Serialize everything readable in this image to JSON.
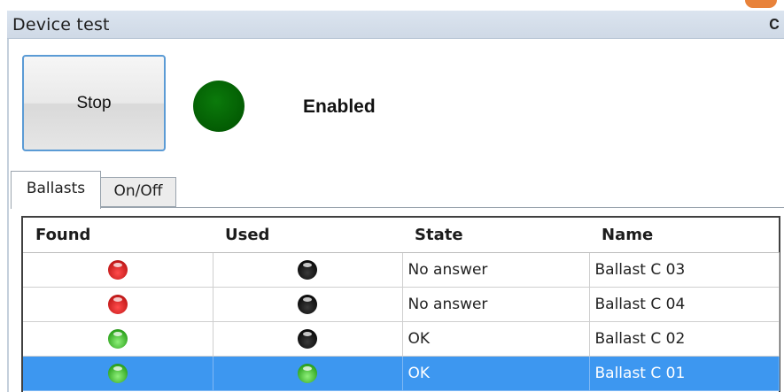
{
  "panel": {
    "title": "Device test"
  },
  "controls": {
    "stop_label": "Stop",
    "status_text": "Enabled",
    "status_color": "#036603"
  },
  "tabs": [
    {
      "label": "Ballasts",
      "active": true
    },
    {
      "label": "On/Off",
      "active": false
    }
  ],
  "grid": {
    "columns": [
      "Found",
      "Used",
      "State",
      "Name"
    ],
    "rows": [
      {
        "found": "red",
        "used": "black",
        "state": "No answer",
        "name": "Ballast C 03",
        "selected": false
      },
      {
        "found": "red",
        "used": "black",
        "state": "No answer",
        "name": "Ballast C 04",
        "selected": false
      },
      {
        "found": "green",
        "used": "black",
        "state": "OK",
        "name": "Ballast C 02",
        "selected": false
      },
      {
        "found": "green",
        "used": "green",
        "state": "OK",
        "name": "Ballast C 01",
        "selected": true
      }
    ]
  },
  "colors": {
    "selection": "#3d97f0",
    "led_red": "#e02020",
    "led_black": "#111111",
    "led_green": "#3cb52a"
  }
}
